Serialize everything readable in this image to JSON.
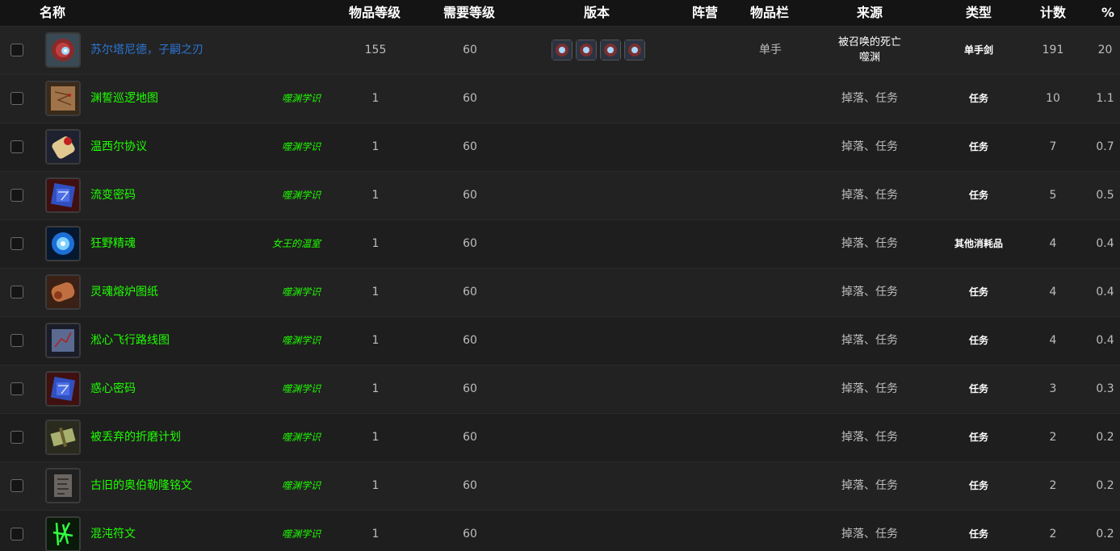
{
  "header": {
    "name": "名称",
    "item_level": "物品等级",
    "req_level": "需要等级",
    "version": "版本",
    "faction": "阵营",
    "slot": "物品栏",
    "source": "来源",
    "type": "类型",
    "count": "计数",
    "percent": "%"
  },
  "rows": [
    {
      "name": "苏尔塔尼德，子嗣之刃",
      "quality": "rare",
      "tag": "",
      "ilvl": "155",
      "rlvl": "60",
      "slot": "单手",
      "source": "被召唤的死亡",
      "source_line2": "噬渊",
      "type": "单手剑",
      "count": "191",
      "pct": "20",
      "icon": "red-eye-helm-icon",
      "versions": [
        "version-icon",
        "version-icon",
        "version-icon",
        "version-icon"
      ]
    },
    {
      "name": "渊誓巡逻地图",
      "quality": "uncommon",
      "tag": "噬渊学识",
      "ilvl": "1",
      "rlvl": "60",
      "slot": "",
      "source": "掉落、任务",
      "type": "任务",
      "count": "10",
      "pct": "1.1",
      "icon": "map-scroll-icon"
    },
    {
      "name": "温西尔协议",
      "quality": "uncommon",
      "tag": "噬渊学识",
      "ilvl": "1",
      "rlvl": "60",
      "slot": "",
      "source": "掉落、任务",
      "type": "任务",
      "count": "7",
      "pct": "0.7",
      "icon": "sealed-scroll-icon"
    },
    {
      "name": "流变密码",
      "quality": "uncommon",
      "tag": "噬渊学识",
      "ilvl": "1",
      "rlvl": "60",
      "slot": "",
      "source": "掉落、任务",
      "type": "任务",
      "count": "5",
      "pct": "0.5",
      "icon": "cipher-cube-icon"
    },
    {
      "name": "狂野精魂",
      "quality": "uncommon",
      "tag": "女王的温室",
      "ilvl": "1",
      "rlvl": "60",
      "slot": "",
      "source": "掉落、任务",
      "type": "其他消耗品",
      "count": "4",
      "pct": "0.4",
      "icon": "blue-orb-icon"
    },
    {
      "name": "灵魂熔炉图纸",
      "quality": "uncommon",
      "tag": "噬渊学识",
      "ilvl": "1",
      "rlvl": "60",
      "slot": "",
      "source": "掉落、任务",
      "type": "任务",
      "count": "4",
      "pct": "0.4",
      "icon": "blueprint-scroll-icon"
    },
    {
      "name": "淞心飞行路线图",
      "quality": "uncommon",
      "tag": "噬渊学识",
      "ilvl": "1",
      "rlvl": "60",
      "slot": "",
      "source": "掉落、任务",
      "type": "任务",
      "count": "4",
      "pct": "0.4",
      "icon": "flight-map-icon"
    },
    {
      "name": "惑心密码",
      "quality": "uncommon",
      "tag": "噬渊学识",
      "ilvl": "1",
      "rlvl": "60",
      "slot": "",
      "source": "掉落、任务",
      "type": "任务",
      "count": "3",
      "pct": "0.3",
      "icon": "cipher-cube-icon"
    },
    {
      "name": "被丢弃的折磨计划",
      "quality": "uncommon",
      "tag": "噬渊学识",
      "ilvl": "1",
      "rlvl": "60",
      "slot": "",
      "source": "掉落、任务",
      "type": "任务",
      "count": "2",
      "pct": "0.2",
      "icon": "bundle-icon"
    },
    {
      "name": "古旧的奥伯勒隆铭文",
      "quality": "uncommon",
      "tag": "噬渊学识",
      "ilvl": "1",
      "rlvl": "60",
      "slot": "",
      "source": "掉落、任务",
      "type": "任务",
      "count": "2",
      "pct": "0.2",
      "icon": "stone-tablet-icon"
    },
    {
      "name": "混沌符文",
      "quality": "uncommon",
      "tag": "噬渊学识",
      "ilvl": "1",
      "rlvl": "60",
      "slot": "",
      "source": "掉落、任务",
      "type": "任务",
      "count": "2",
      "pct": "0.2",
      "icon": "green-rune-icon"
    }
  ],
  "colors": {
    "uncommon": "#1eff00",
    "rare": "#2b76d4"
  }
}
